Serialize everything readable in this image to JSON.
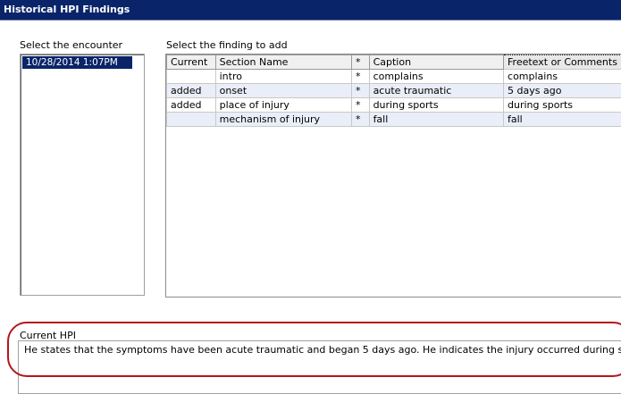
{
  "window": {
    "title": "Historical HPI Findings"
  },
  "encounter": {
    "label": "Select the encounter",
    "items": [
      "10/28/2014  1:07PM"
    ]
  },
  "findings": {
    "label": "Select the finding to add",
    "columns": [
      "Current",
      "Section Name",
      "*",
      "Caption",
      "Freetext or Comments"
    ],
    "rows": [
      [
        "",
        "intro",
        "*",
        "complains",
        "complains"
      ],
      [
        "added",
        "onset",
        "*",
        "acute traumatic",
        "5 days ago"
      ],
      [
        "added",
        "place of injury",
        "*",
        "during sports",
        "during sports"
      ],
      [
        "",
        "mechanism of injury",
        "*",
        "fall",
        "fall"
      ]
    ]
  },
  "current_hpi": {
    "label": "Current HPI",
    "text": "He states that the symptoms have been acute traumatic and began 5 days ago. He indicates the injury occurred during sports."
  },
  "colors": {
    "titlebar": "#0a246a",
    "selection": "#0a246a",
    "alt_row": "#e9eef8",
    "annotation_ring": "#b5161c"
  }
}
